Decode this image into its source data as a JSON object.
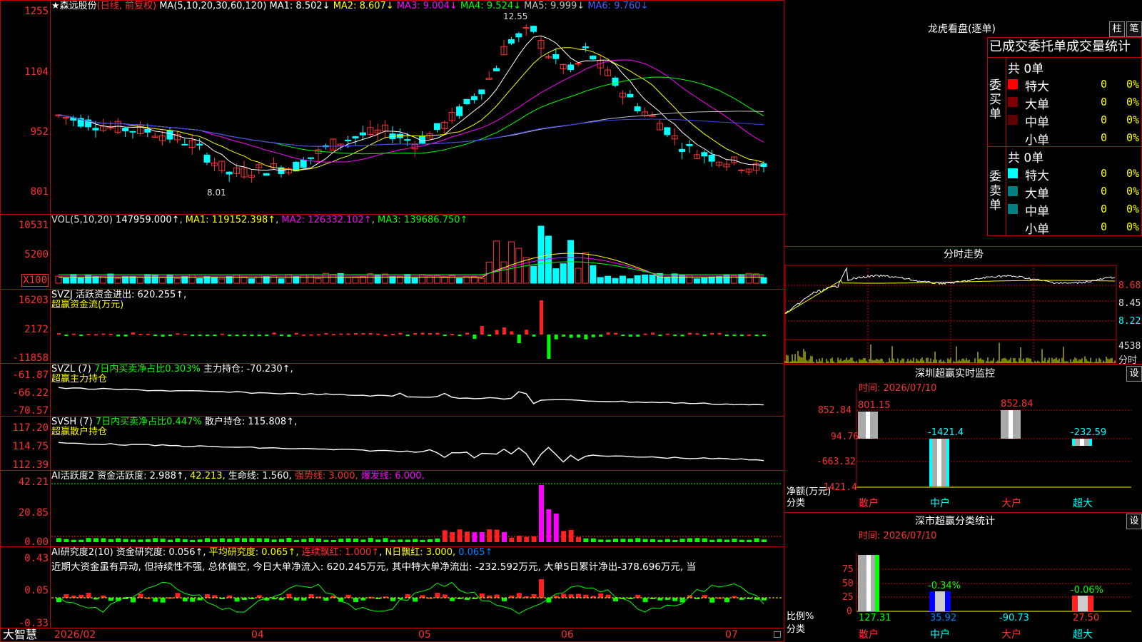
{
  "colors": {
    "up": "#ff3333",
    "down": "#00ffff",
    "ma1": "#ffffff",
    "ma2": "#ffff00",
    "ma3": "#ff00ff",
    "ma4": "#00ff00",
    "ma5": "#c0c0c0",
    "ma6": "#4040ff",
    "grid": "#c00000",
    "axis": "#ff3030",
    "green": "#00ff00",
    "yellow": "#ffff00"
  },
  "header": {
    "title": "★森远股份",
    "mode": "(日线, 前复权)",
    "ma_label": "MA(5,10,20,30,60,120)",
    "ma1": "MA1: 8.502↓",
    "ma2": "MA2: 8.607↓",
    "ma3": "MA3: 9.004↓",
    "ma4": "MA4: 9.524↓",
    "ma5": "MA5: 9.999↓",
    "ma6": "MA6: 9.760↓"
  },
  "price_axis": [
    "1255",
    "1104",
    "952",
    "801"
  ],
  "price_high_label": "12.55",
  "price_low_label": "8.01",
  "vol": {
    "label": "VOL(5,10,20)",
    "value": "147959.000↑",
    "ma1": "MA1: 119152.398↑",
    "ma2": "MA2: 126332.102↑",
    "ma3": "MA3: 139686.750↑",
    "axis": [
      "10531",
      "5200",
      "X100"
    ]
  },
  "svzj": {
    "label": "SVZJ  活跃资金进出: 620.255↑,",
    "sub": "超赢资金流(万元)",
    "axis": [
      "16203",
      "2172",
      "-11858"
    ]
  },
  "svzl": {
    "label": "SVZL (7)",
    "green": "7日内买卖净占比0.303%",
    "main": "主力持仓: -70.230↑,",
    "sub": "超赢主力持仓",
    "axis": [
      "-61.87",
      "-66.22",
      "-70.57"
    ]
  },
  "svsh": {
    "label": "SVSH (7)",
    "green": "7日内买卖净占比0.447%",
    "main": "散户持仓: 115.808↑,",
    "sub": "超赢散户持仓",
    "axis": [
      "117.20",
      "114.75",
      "112.39"
    ]
  },
  "ai1": {
    "label": "AI活跃度2 资金活跃度: 2.988↑,",
    "yellow": "42.213,",
    "mid": "生命线: 1.560,",
    "red1": "强势线: 3.000,",
    "red2": "爆发线: 6.000,",
    "axis": [
      "42.21",
      "20.85",
      "0.00"
    ]
  },
  "ai2": {
    "label": "AI研究度2(10) 资金研究度: 0.056↑,",
    "yellow": "平均研究度: 0.065↑,",
    "red": "连续飘红: 1.000↑",
    "green": "N日飘红: 3.000,",
    "blue": "0.065↑",
    "text": "近期大资金虽有异动, 但持续性不强, 总体偏空, 今日大单净流入: 620.245万元, 其中特大单净流出: -232.592万元, 大单5日累计净出-378.696万元, 当",
    "axis": [
      "0.43",
      "0.05",
      "-0.33"
    ]
  },
  "bottom": {
    "brand": "大智慧",
    "dates": [
      "2026/02",
      "04",
      "05",
      "06",
      "07"
    ]
  },
  "right": {
    "lhb_title": "龙虎看盘(逐单)",
    "btn1": "柱",
    "btn2": "笔",
    "tabs": "已成交委托单成交量统计",
    "buy_label": "委买单",
    "sell_label": "委卖单",
    "buy_total": "共 0单",
    "sell_total": "共 0单",
    "rows": [
      {
        "name": "特大",
        "v": "0",
        "p": "0%"
      },
      {
        "name": "大单",
        "v": "0",
        "p": "0%"
      },
      {
        "name": "中单",
        "v": "0",
        "p": "0%"
      },
      {
        "name": "小单",
        "v": "0",
        "p": "0%"
      }
    ],
    "fs_title": "分时走势",
    "fs_axis": [
      "8.68",
      "8.45",
      "8.22",
      "4538",
      "分时"
    ],
    "sz_title": "深圳超赢实时监控",
    "sz_btn": "设",
    "sz_time": "时间: 2026/07/10",
    "sz_axis": [
      "852.84",
      "94.76",
      "-663.32",
      "-1421.4"
    ],
    "sz_vals": [
      "801.15",
      "-1421.4",
      "852.84",
      "-232.59"
    ],
    "sz_ylabel": "净额(万元)",
    "sz_xlabel": "分类",
    "cats": [
      "散户",
      "中户",
      "大户",
      "超大"
    ],
    "ss_title": "深市超赢分类统计",
    "ss_btn": "设",
    "ss_time": "时间: 2026/07/10",
    "ss_axis": [
      "75",
      "50",
      "25",
      "0"
    ],
    "ss_pcts": [
      "-0.34%",
      "-0.06%"
    ],
    "ss_vals": [
      "127.31",
      "35.92",
      "-90.73",
      "27.50"
    ],
    "ss_ylabel": "比例%",
    "ss_xlabel": "分类"
  }
}
